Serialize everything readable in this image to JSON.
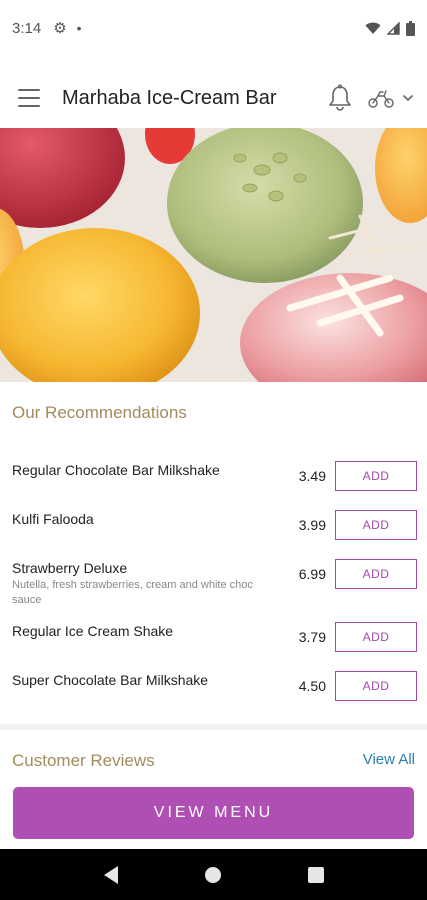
{
  "status_bar": {
    "time": "3:14",
    "gear_icon": "gear-icon",
    "dot": "•"
  },
  "app_bar": {
    "title": "Marhaba Ice-Cream Bar"
  },
  "recommendations": {
    "title": "Our Recommendations",
    "add_label": "ADD",
    "items": [
      {
        "name": "Regular Chocolate Bar Milkshake",
        "desc": "",
        "price": "3.49"
      },
      {
        "name": "Kulfi Falooda",
        "desc": "",
        "price": "3.99"
      },
      {
        "name": "Strawberry Deluxe",
        "desc": "Nutella, fresh strawberries, cream and white choc sauce",
        "price": "6.99"
      },
      {
        "name": "Regular Ice Cream Shake",
        "desc": "",
        "price": "3.79"
      },
      {
        "name": "Super Chocolate Bar Milkshake",
        "desc": "",
        "price": "4.50"
      }
    ]
  },
  "reviews": {
    "title": "Customer Reviews",
    "view_all": "View All"
  },
  "view_menu": {
    "label": "VIEW MENU"
  },
  "colors": {
    "accent": "#b04fb3",
    "heading": "#a48a5c",
    "link": "#2a7fb3"
  }
}
